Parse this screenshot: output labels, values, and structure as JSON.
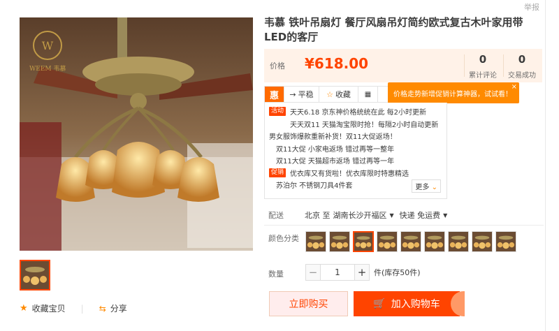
{
  "report_label": "举报",
  "brand": {
    "logo_text": "WEEM 韦慕"
  },
  "title": "韦慕 铁叶吊扇灯 餐厅风扇吊灯简约欧式复古木叶家用带LED的客厅",
  "price": {
    "label": "价格",
    "value": "¥618.00"
  },
  "stats": [
    {
      "number": "0",
      "label": "累计评论"
    },
    {
      "number": "0",
      "label": "交易成功"
    }
  ],
  "toolbar": {
    "logo": "惠",
    "items": [
      "平稳",
      "收藏",
      "█"
    ]
  },
  "tip": {
    "text": "价格走势新增促销计算神器，试试看！",
    "close": "×"
  },
  "promos": [
    {
      "tag": "活动",
      "text": "天天6.18 京东神价格统统在此 每2小时更新"
    },
    {
      "tag": "",
      "text": "天天双11 天猫淘宝限时抢！每隔2小时自动更新"
    },
    {
      "tag": "",
      "text": "男女服饰爆款重新补货！双11大促返场！"
    },
    {
      "tag": "",
      "text": "双11大促 小家电返场 错过再等一整年"
    },
    {
      "tag": "",
      "text": "双11大促 天猫超市返场 错过再等一年"
    },
    {
      "tag": "促销",
      "text": "优衣库又有货啦！优衣库限时特惠精选"
    },
    {
      "tag": "",
      "text": "苏泊尔 不锈钢刀具4件套"
    }
  ],
  "more_label": "更多",
  "delivery": {
    "label": "配送",
    "from": "北京 至",
    "to": "湖南长沙开福区",
    "method": "快递 免运费"
  },
  "color_label": "颜色分类",
  "swatch_count": 9,
  "selected_swatch": 2,
  "quantity": {
    "label": "数量",
    "value": "1",
    "minus": "−",
    "plus": "+",
    "stock": "件(库存50件)"
  },
  "buttons": {
    "buy": "立即购买",
    "cart": "加入购物车"
  },
  "actions": {
    "favorite": "收藏宝贝",
    "share": "分享"
  },
  "colors": {
    "accent": "#ff4400",
    "orange": "#ff8a00",
    "price_bg": "#fff2e8"
  }
}
